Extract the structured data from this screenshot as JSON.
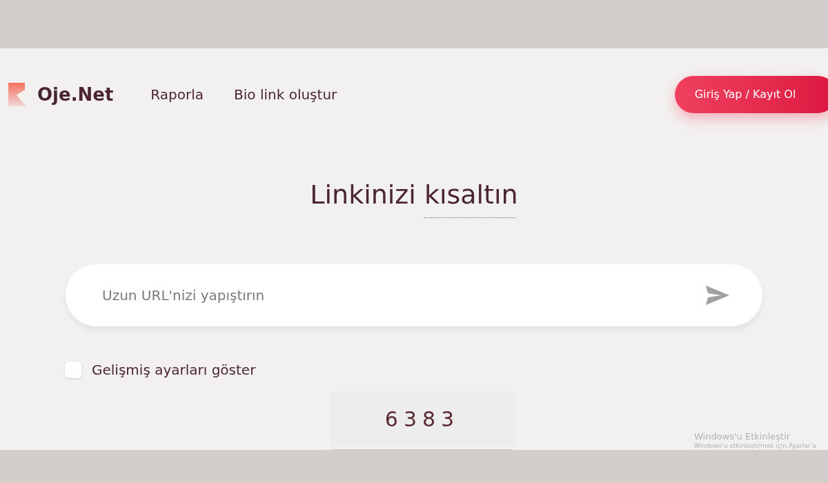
{
  "header": {
    "logo": "Oje.Net",
    "nav": [
      "Raporla",
      "Bio link oluştur"
    ],
    "login_button": "Giriş Yap / Kayıt Ol"
  },
  "title": "Linkinizi kısaltın",
  "url_field": {
    "placeholder": "Uzun URL'nizi yapıştırın"
  },
  "advanced": {
    "label": "Gelişmiş ayarları göster",
    "checked": false
  },
  "captcha": {
    "code": "6383"
  },
  "activation_notice": {
    "title": "Windows'u Etkinleştir",
    "text": "Windows'u etkinleştirmek için Ayarlar'a"
  }
}
